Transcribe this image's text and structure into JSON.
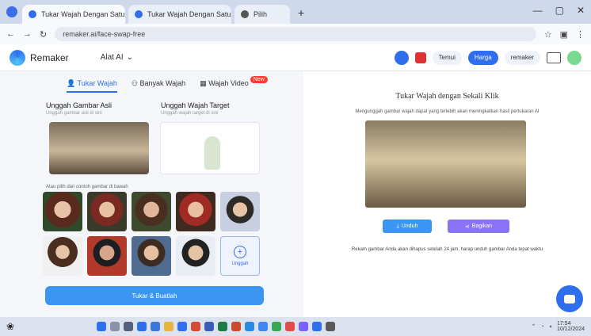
{
  "browser": {
    "tabs": [
      {
        "title": "Tukar Wajah Dengan Satu Klik"
      },
      {
        "title": "Tukar Wajah Dengan Satu Klik"
      },
      {
        "title": "Pilih"
      }
    ],
    "new_tab": "+",
    "address": "remaker.ai/face-swap-free",
    "window_controls": [
      "—",
      "▢",
      "✕"
    ]
  },
  "app": {
    "brand": "Remaker",
    "menu": "Alat AI",
    "pill1": "Temui",
    "pill2": "Harga",
    "user": "remaker"
  },
  "left": {
    "tabs": [
      {
        "label": "Tukar Wajah",
        "active": true
      },
      {
        "label": "Banyak Wajah"
      },
      {
        "label": "Wajah Video",
        "badge": "New"
      }
    ],
    "upload_original_label": "Unggah Gambar Asli",
    "upload_original_sub": "Unggah gambar asli di sini",
    "upload_target_label": "Unggah Wajah Target",
    "upload_target_sub": "Unggah wajah target di sini",
    "samples_caption": "Atau pilih dari contoh gambar di bawah",
    "add_label": "Unggah",
    "primary_button": "Tukar & Buatlah"
  },
  "right": {
    "title": "Tukar Wajah dengan Sekali Klik",
    "description": "Mengunggah gambar wajah dapat yang terlebih akan meningkatkan hasil pertukaran AI",
    "download_button": "Unduh",
    "share_button": "Bagikan",
    "note": "Rekam gambar Anda akan dihapus setelah 24 jam, harap unduh gambar Anda tepat waktu"
  },
  "taskbar": {
    "time": "17:54",
    "date": "10/12/2024"
  }
}
